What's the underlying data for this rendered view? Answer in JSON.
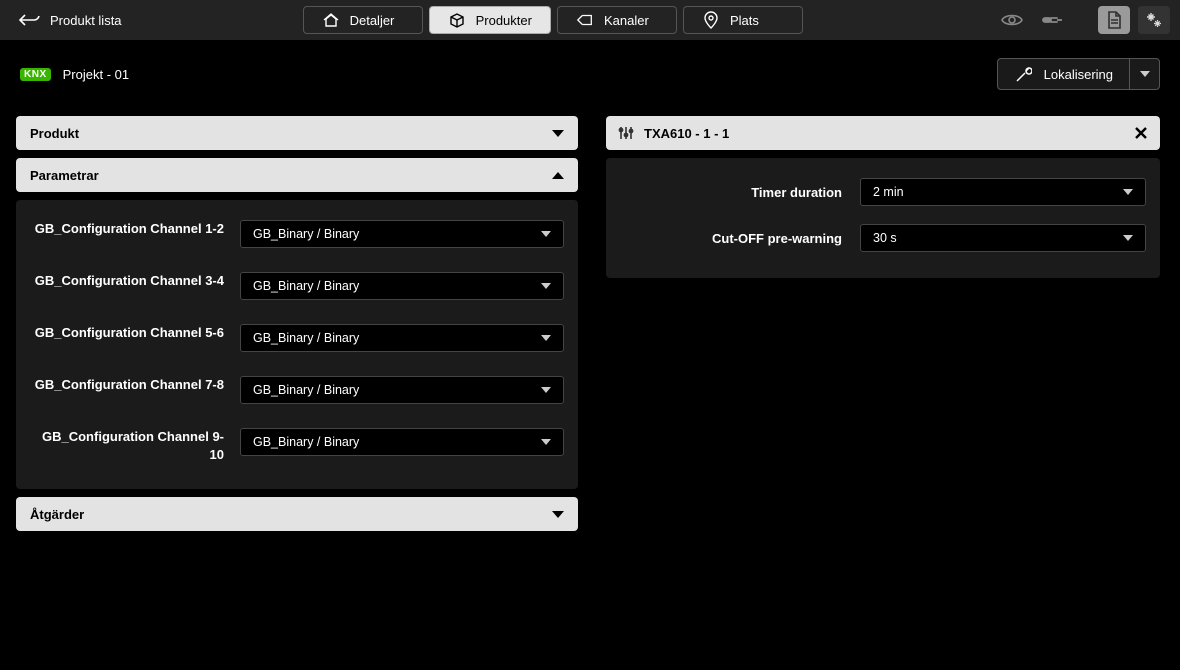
{
  "topbar": {
    "back_label": "Produkt lista",
    "tabs": {
      "details": "Detaljer",
      "products": "Produkter",
      "channels": "Kanaler",
      "location": "Plats"
    }
  },
  "subbar": {
    "brand": "KNX",
    "project_title": "Projekt - 01",
    "locate_label": "Lokalisering"
  },
  "left": {
    "product_header": "Produkt",
    "params_header": "Parametrar",
    "actions_header": "Åtgärder",
    "params": [
      {
        "label": "GB_Configuration Channel 1-2",
        "value": "GB_Binary / Binary"
      },
      {
        "label": "GB_Configuration Channel 3-4",
        "value": "GB_Binary / Binary"
      },
      {
        "label": "GB_Configuration Channel 5-6",
        "value": "GB_Binary / Binary"
      },
      {
        "label": "GB_Configuration Channel 7-8",
        "value": "GB_Binary / Binary"
      },
      {
        "label": "GB_Configuration Channel 9-10",
        "value": "GB_Binary / Binary"
      }
    ]
  },
  "right": {
    "title": "TXA610 - 1 - 1",
    "rows": [
      {
        "label": "Timer duration",
        "value": "2 min"
      },
      {
        "label": "Cut-OFF pre-warning",
        "value": "30 s"
      }
    ]
  }
}
